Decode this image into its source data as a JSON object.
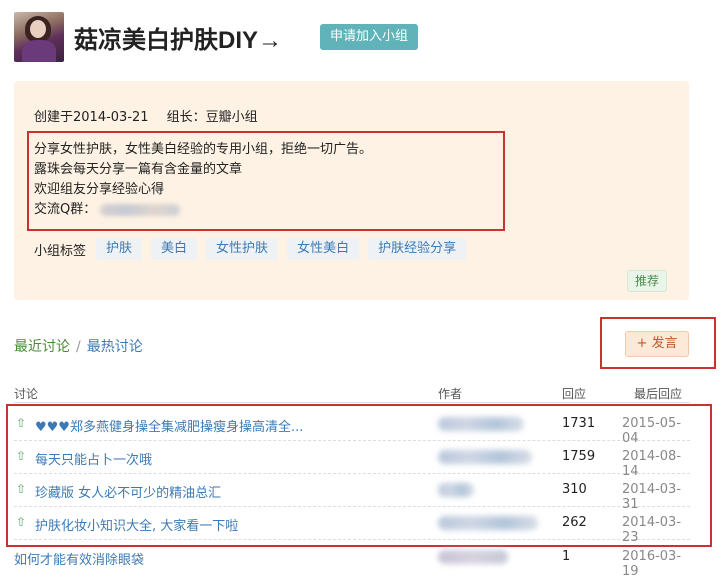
{
  "group": {
    "title": "菇凉美白护肤DIY→",
    "join_button": "申请加入小组",
    "created": "创建于2014-03-21",
    "owner": "组长：豆瓣小组",
    "description": [
      "分享女性护肤，女性美白经验的专用小组，拒绝一切广告。",
      "露珠会每天分享一篇有含金量的文章",
      "欢迎组友分享经验心得",
      "交流Q群："
    ],
    "tags_label": "小组标签",
    "tags": [
      "护肤",
      "美白",
      "女性护肤",
      "女性美白",
      "护肤经验分享"
    ],
    "recommend_button": "推荐"
  },
  "discussions": {
    "tab_recent": "最近讨论",
    "tab_separator": "/",
    "tab_hot": "最热讨论",
    "post_button": "+ 发言",
    "headers": {
      "topic": "讨论",
      "author": "作者",
      "replies": "回应",
      "last_reply": "最后回应"
    },
    "rows": [
      {
        "pinned": true,
        "topic": "♥♥♥郑多燕健身操全集减肥操瘦身操高清全...",
        "replies": "1731",
        "last_reply": "2015-05-04"
      },
      {
        "pinned": true,
        "topic": "每天只能占卜一次哦",
        "replies": "1759",
        "last_reply": "2014-08-14"
      },
      {
        "pinned": true,
        "topic": "珍藏版 女人必不可少的精油总汇",
        "replies": "310",
        "last_reply": "2014-03-31"
      },
      {
        "pinned": true,
        "topic": "护肤化妆小知识大全, 大家看一下啦",
        "replies": "262",
        "last_reply": "2014-03-23"
      },
      {
        "pinned": false,
        "topic": "如何才能有效消除眼袋",
        "replies": "1",
        "last_reply": "2016-03-19"
      }
    ]
  },
  "icons": {
    "pinned_arrow": "⇧"
  },
  "colors": {
    "accent_teal": "#5fb3b9",
    "link_blue": "#3d7ab5",
    "info_bg": "#fdf2e4",
    "highlight_red": "#c8332f"
  }
}
